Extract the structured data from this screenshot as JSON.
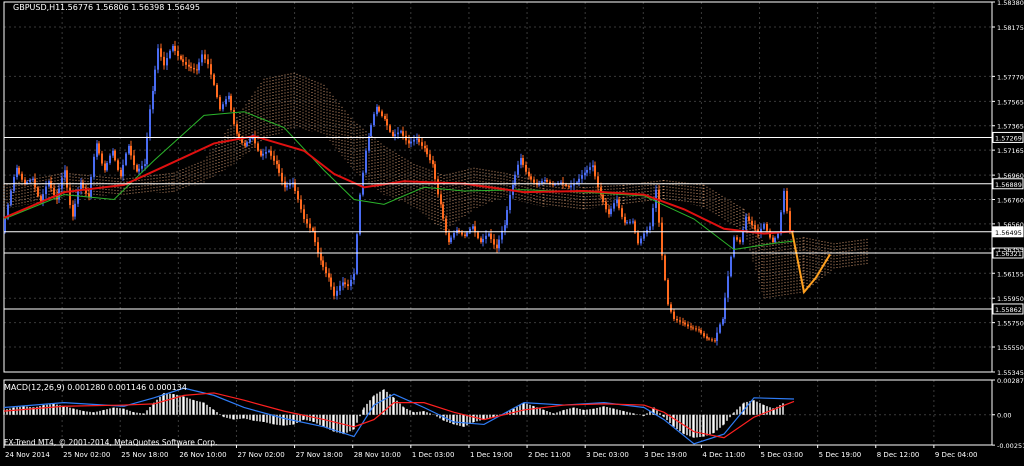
{
  "header": {
    "symbol": "GBPUSD,H1",
    "ohlc": "1.56776 1.56806 1.56398 1.56495",
    "macd_label": "MACD(12,26,9) 0.001280 0.001146 0.000134",
    "copyright": "FX-Trend MT4, © 2001-2014, MetaQuotes Software Corp."
  },
  "colors": {
    "background": "#000000",
    "grid": "#3a3a3a",
    "axis": "#ffffff",
    "bull": "#4a6cf2",
    "bear": "#ff6a1f",
    "ma_red": "#e01010",
    "ma_green": "#2bb52b",
    "cloud": "#f0b080",
    "macd_hist": "#ffffff",
    "macd_blue": "#2f7cf6",
    "macd_red": "#ff2020",
    "hline": "#ffffff",
    "projection": "#ffa020"
  },
  "chart_data": [
    {
      "type": "candlestick",
      "title": "GBPUSD,H1",
      "ylim": [
        1.55345,
        1.5838
      ],
      "grid": true,
      "y_ticks": [
        "1.58380",
        "1.58175",
        "1.57770",
        "1.57565",
        "1.57365",
        "1.57165",
        "1.56960",
        "1.56760",
        "1.56560",
        "1.56355",
        "1.56155",
        "1.55950",
        "1.55750",
        "1.55550",
        "1.55345"
      ],
      "x_ticks": [
        "24 Nov 2014",
        "25 Nov 02:00",
        "25 Nov 18:00",
        "26 Nov 10:00",
        "27 Nov 02:00",
        "27 Nov 18:00",
        "28 Nov 10:00",
        "1 Dec 03:00",
        "1 Dec 19:00",
        "2 Dec 11:00",
        "3 Dec 03:00",
        "3 Dec 19:00",
        "4 Dec 11:00",
        "5 Dec 03:00",
        "5 Dec 19:00",
        "8 Dec 12:00",
        "9 Dec 04:00"
      ],
      "horizontal_levels": [
        {
          "value": 1.57269,
          "label": "1.57269"
        },
        {
          "value": 1.56889,
          "label": "1.56889"
        },
        {
          "value": 1.56495,
          "label": "1.56495",
          "current": true
        },
        {
          "value": 1.56321,
          "label": "1.56321"
        },
        {
          "value": 1.55862,
          "label": "1.55862"
        }
      ],
      "price_path": [
        [
          0,
          1.5649
        ],
        [
          14,
          1.5702
        ],
        [
          22,
          1.5689
        ],
        [
          30,
          1.5693
        ],
        [
          38,
          1.5674
        ],
        [
          46,
          1.5691
        ],
        [
          54,
          1.5676
        ],
        [
          62,
          1.57
        ],
        [
          70,
          1.5662
        ],
        [
          78,
          1.569
        ],
        [
          86,
          1.5678
        ],
        [
          94,
          1.5722
        ],
        [
          102,
          1.57
        ],
        [
          110,
          1.5716
        ],
        [
          118,
          1.5695
        ],
        [
          126,
          1.572
        ],
        [
          134,
          1.5699
        ],
        [
          142,
          1.5705
        ],
        [
          150,
          1.5765
        ],
        [
          156,
          1.58
        ],
        [
          162,
          1.5786
        ],
        [
          170,
          1.5802
        ],
        [
          178,
          1.5791
        ],
        [
          186,
          1.5785
        ],
        [
          194,
          1.5782
        ],
        [
          200,
          1.5795
        ],
        [
          206,
          1.5787
        ],
        [
          212,
          1.577
        ],
        [
          218,
          1.575
        ],
        [
          226,
          1.5761
        ],
        [
          234,
          1.573
        ],
        [
          242,
          1.572
        ],
        [
          250,
          1.5728
        ],
        [
          258,
          1.5712
        ],
        [
          266,
          1.5716
        ],
        [
          274,
          1.5705
        ],
        [
          282,
          1.5686
        ],
        [
          290,
          1.569
        ],
        [
          296,
          1.5676
        ],
        [
          302,
          1.566
        ],
        [
          310,
          1.565
        ],
        [
          318,
          1.5626
        ],
        [
          326,
          1.5612
        ],
        [
          332,
          1.5597
        ],
        [
          340,
          1.5608
        ],
        [
          346,
          1.5605
        ],
        [
          352,
          1.5615
        ],
        [
          358,
          1.568
        ],
        [
          366,
          1.5728
        ],
        [
          374,
          1.5752
        ],
        [
          382,
          1.5742
        ],
        [
          390,
          1.5728
        ],
        [
          398,
          1.5732
        ],
        [
          406,
          1.5722
        ],
        [
          414,
          1.5726
        ],
        [
          422,
          1.5718
        ],
        [
          430,
          1.5705
        ],
        [
          438,
          1.5672
        ],
        [
          446,
          1.5641
        ],
        [
          454,
          1.5651
        ],
        [
          462,
          1.5646
        ],
        [
          470,
          1.5654
        ],
        [
          478,
          1.5641
        ],
        [
          486,
          1.5648
        ],
        [
          494,
          1.5636
        ],
        [
          502,
          1.5655
        ],
        [
          510,
          1.5688
        ],
        [
          518,
          1.571
        ],
        [
          526,
          1.5695
        ],
        [
          534,
          1.5688
        ],
        [
          542,
          1.5692
        ],
        [
          550,
          1.5688
        ],
        [
          558,
          1.569
        ],
        [
          566,
          1.5686
        ],
        [
          574,
          1.569
        ],
        [
          582,
          1.5698
        ],
        [
          590,
          1.5704
        ],
        [
          598,
          1.568
        ],
        [
          606,
          1.5664
        ],
        [
          614,
          1.5676
        ],
        [
          622,
          1.5657
        ],
        [
          630,
          1.5658
        ],
        [
          636,
          1.564
        ],
        [
          642,
          1.5648
        ],
        [
          648,
          1.5654
        ],
        [
          654,
          1.5684
        ],
        [
          660,
          1.563
        ],
        [
          666,
          1.559
        ],
        [
          672,
          1.5578
        ],
        [
          680,
          1.5575
        ],
        [
          688,
          1.5571
        ],
        [
          696,
          1.5569
        ],
        [
          704,
          1.5562
        ],
        [
          712,
          1.556
        ],
        [
          720,
          1.5578
        ],
        [
          726,
          1.5613
        ],
        [
          732,
          1.5645
        ],
        [
          738,
          1.5641
        ],
        [
          744,
          1.5662
        ],
        [
          750,
          1.5655
        ],
        [
          756,
          1.5648
        ],
        [
          762,
          1.5656
        ],
        [
          770,
          1.5641
        ],
        [
          776,
          1.5648
        ],
        [
          782,
          1.5683
        ],
        [
          788,
          1.565
        ]
      ],
      "projection": [
        [
          788,
          1.565
        ],
        [
          800,
          1.56
        ],
        [
          812,
          1.5612
        ],
        [
          826,
          1.5631
        ]
      ],
      "ma_red": [
        [
          0,
          1.5661
        ],
        [
          60,
          1.5682
        ],
        [
          120,
          1.5688
        ],
        [
          160,
          1.5703
        ],
        [
          210,
          1.5722
        ],
        [
          250,
          1.5728
        ],
        [
          300,
          1.5716
        ],
        [
          330,
          1.5697
        ],
        [
          360,
          1.5686
        ],
        [
          400,
          1.5691
        ],
        [
          460,
          1.5689
        ],
        [
          520,
          1.5682
        ],
        [
          580,
          1.5683
        ],
        [
          640,
          1.568
        ],
        [
          680,
          1.5668
        ],
        [
          720,
          1.5652
        ],
        [
          760,
          1.5648
        ],
        [
          790,
          1.565
        ]
      ],
      "ma_green": [
        [
          0,
          1.566
        ],
        [
          60,
          1.568
        ],
        [
          110,
          1.5676
        ],
        [
          150,
          1.5708
        ],
        [
          200,
          1.5745
        ],
        [
          240,
          1.5748
        ],
        [
          280,
          1.5735
        ],
        [
          320,
          1.57
        ],
        [
          350,
          1.5676
        ],
        [
          380,
          1.5672
        ],
        [
          420,
          1.5686
        ],
        [
          460,
          1.5683
        ],
        [
          520,
          1.5684
        ],
        [
          580,
          1.5682
        ],
        [
          640,
          1.5679
        ],
        [
          690,
          1.566
        ],
        [
          730,
          1.5635
        ],
        [
          770,
          1.564
        ],
        [
          790,
          1.5642
        ]
      ],
      "cloud": [
        [
          0,
          1.5668,
          1.5688
        ],
        [
          60,
          1.5678,
          1.5698
        ],
        [
          120,
          1.568,
          1.5693
        ],
        [
          170,
          1.5682,
          1.5698
        ],
        [
          200,
          1.569,
          1.5708
        ],
        [
          230,
          1.5705,
          1.574
        ],
        [
          260,
          1.5725,
          1.5775
        ],
        [
          290,
          1.5735,
          1.578
        ],
        [
          320,
          1.573,
          1.577
        ],
        [
          350,
          1.57,
          1.574
        ],
        [
          380,
          1.568,
          1.572
        ],
        [
          410,
          1.567,
          1.5705
        ],
        [
          440,
          1.565,
          1.5696
        ],
        [
          470,
          1.5668,
          1.5702
        ],
        [
          500,
          1.5678,
          1.5698
        ],
        [
          540,
          1.567,
          1.569
        ],
        [
          580,
          1.5668,
          1.5686
        ],
        [
          620,
          1.5672,
          1.5688
        ],
        [
          660,
          1.5676,
          1.5692
        ],
        [
          700,
          1.567,
          1.5688
        ],
        [
          740,
          1.565,
          1.5668
        ],
        [
          760,
          1.5595,
          1.564
        ],
        [
          800,
          1.56,
          1.5645
        ],
        [
          830,
          1.5618,
          1.564
        ],
        [
          866,
          1.5622,
          1.5644
        ]
      ]
    },
    {
      "type": "histogram",
      "title": "MACD(12,26,9) 0.001280 0.001146 0.000134",
      "ylim": [
        -0.0025,
        0.002871
      ],
      "y_ticks": [
        "0.002871",
        "0.00",
        "-0.002510"
      ],
      "histogram": [
        [
          0,
          0.0004
        ],
        [
          10,
          0.0006
        ],
        [
          20,
          0.0007
        ],
        [
          30,
          0.0006
        ],
        [
          40,
          0.0008
        ],
        [
          50,
          0.0009
        ],
        [
          60,
          0.0007
        ],
        [
          70,
          0.0005
        ],
        [
          80,
          0.0003
        ],
        [
          90,
          0.0002
        ],
        [
          100,
          0.0004
        ],
        [
          110,
          0.0006
        ],
        [
          120,
          0.0005
        ],
        [
          130,
          0.0002
        ],
        [
          140,
          0.0001
        ],
        [
          150,
          0.001
        ],
        [
          160,
          0.0018
        ],
        [
          170,
          0.0017
        ],
        [
          180,
          0.0015
        ],
        [
          190,
          0.0012
        ],
        [
          200,
          0.001
        ],
        [
          210,
          0.0004
        ],
        [
          220,
          -0.0002
        ],
        [
          230,
          -0.0004
        ],
        [
          240,
          -0.0003
        ],
        [
          250,
          -0.0005
        ],
        [
          260,
          -0.0006
        ],
        [
          270,
          -0.0008
        ],
        [
          280,
          -0.0009
        ],
        [
          290,
          -0.0008
        ],
        [
          300,
          -0.0004
        ],
        [
          310,
          -0.0006
        ],
        [
          320,
          -0.001
        ],
        [
          330,
          -0.0014
        ],
        [
          340,
          -0.0016
        ],
        [
          350,
          -0.0012
        ],
        [
          360,
          0.0006
        ],
        [
          370,
          0.0016
        ],
        [
          380,
          0.0021
        ],
        [
          390,
          0.0014
        ],
        [
          400,
          0.0006
        ],
        [
          410,
          0.0002
        ],
        [
          420,
          0.0003
        ],
        [
          430,
          0.0
        ],
        [
          440,
          -0.0005
        ],
        [
          450,
          -0.0008
        ],
        [
          460,
          -0.001
        ],
        [
          470,
          -0.0006
        ],
        [
          480,
          -0.0004
        ],
        [
          490,
          -0.0002
        ],
        [
          500,
          0.0001
        ],
        [
          510,
          0.0005
        ],
        [
          520,
          0.001
        ],
        [
          530,
          0.0007
        ],
        [
          540,
          0.0004
        ],
        [
          550,
          0.0001
        ],
        [
          560,
          0.0004
        ],
        [
          570,
          0.0006
        ],
        [
          580,
          0.0004
        ],
        [
          590,
          0.0005
        ],
        [
          600,
          0.0007
        ],
        [
          610,
          0.0005
        ],
        [
          620,
          0.0003
        ],
        [
          630,
          0.0001
        ],
        [
          640,
          -0.0001
        ],
        [
          650,
          0.0006
        ],
        [
          660,
          -0.0002
        ],
        [
          670,
          -0.001
        ],
        [
          680,
          -0.0016
        ],
        [
          690,
          -0.0019
        ],
        [
          700,
          -0.0018
        ],
        [
          710,
          -0.0015
        ],
        [
          720,
          -0.0008
        ],
        [
          730,
          0.0002
        ],
        [
          740,
          0.001
        ],
        [
          750,
          0.0012
        ],
        [
          760,
          0.0008
        ],
        [
          770,
          0.0005
        ],
        [
          780,
          0.001
        ]
      ],
      "macd_line": [
        [
          0,
          0.0006
        ],
        [
          60,
          0.001
        ],
        [
          120,
          0.0007
        ],
        [
          150,
          0.0014
        ],
        [
          180,
          0.0022
        ],
        [
          210,
          0.0016
        ],
        [
          240,
          0.0006
        ],
        [
          280,
          -0.0003
        ],
        [
          320,
          -0.001
        ],
        [
          350,
          -0.0018
        ],
        [
          370,
          0.0008
        ],
        [
          390,
          0.0017
        ],
        [
          420,
          0.0006
        ],
        [
          450,
          -0.0006
        ],
        [
          480,
          -0.0008
        ],
        [
          520,
          0.001
        ],
        [
          560,
          0.0008
        ],
        [
          600,
          0.001
        ],
        [
          640,
          0.0006
        ],
        [
          660,
          -0.0004
        ],
        [
          690,
          -0.0024
        ],
        [
          720,
          -0.0016
        ],
        [
          750,
          0.0014
        ],
        [
          790,
          0.0013
        ]
      ],
      "signal_line": [
        [
          0,
          0.0003
        ],
        [
          60,
          0.0007
        ],
        [
          120,
          0.0008
        ],
        [
          150,
          0.0009
        ],
        [
          180,
          0.0016
        ],
        [
          210,
          0.0018
        ],
        [
          240,
          0.0012
        ],
        [
          280,
          0.0003
        ],
        [
          320,
          -0.0004
        ],
        [
          350,
          -0.001
        ],
        [
          370,
          -0.0004
        ],
        [
          390,
          0.001
        ],
        [
          420,
          0.001
        ],
        [
          450,
          0.0002
        ],
        [
          480,
          -0.0004
        ],
        [
          520,
          0.0004
        ],
        [
          560,
          0.0008
        ],
        [
          600,
          0.0009
        ],
        [
          640,
          0.0008
        ],
        [
          660,
          0.0002
        ],
        [
          690,
          -0.0014
        ],
        [
          720,
          -0.0019
        ],
        [
          750,
          -0.0002
        ],
        [
          790,
          0.0011
        ]
      ]
    }
  ]
}
